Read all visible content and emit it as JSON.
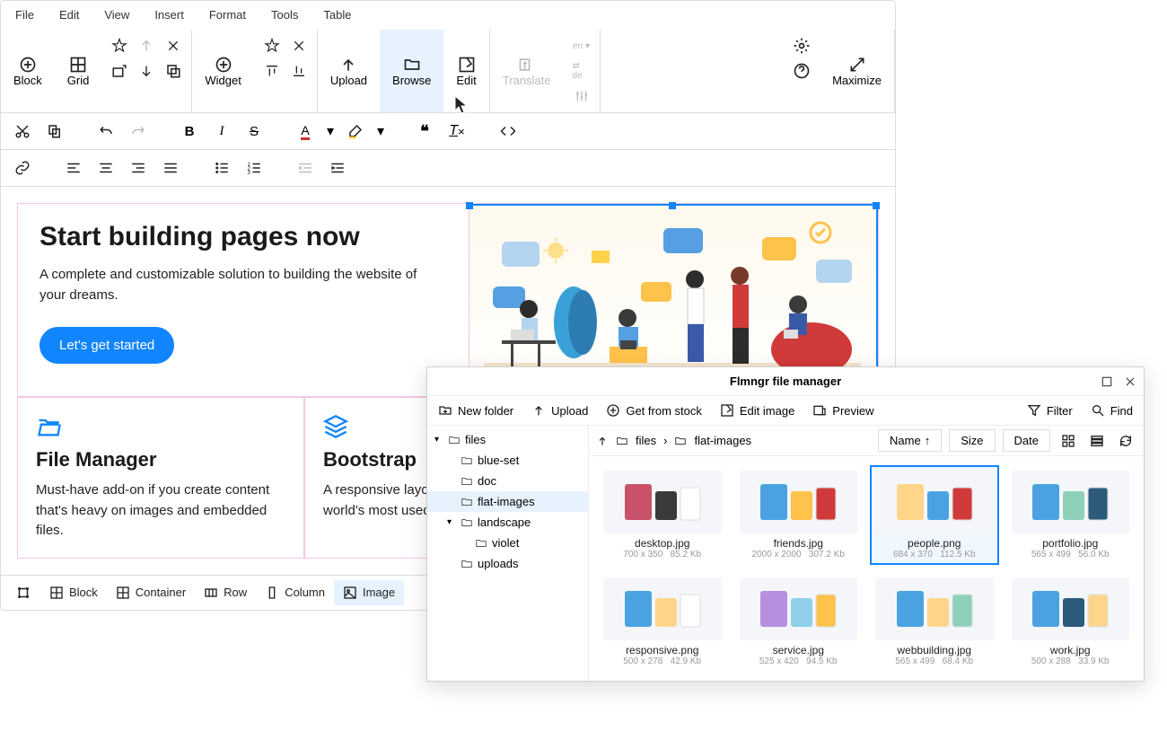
{
  "menu": [
    "File",
    "Edit",
    "View",
    "Insert",
    "Format",
    "Tools",
    "Table"
  ],
  "tools": {
    "block": "Block",
    "grid": "Grid",
    "widget": "Widget",
    "upload": "Upload",
    "browse": "Browse",
    "edit": "Edit",
    "translate": "Translate",
    "maximize": "Maximize"
  },
  "hero": {
    "title": "Start building pages now",
    "desc": "A complete and customizable solution to building the website of your dreams.",
    "cta": "Let's get started"
  },
  "features": [
    {
      "title": "File Manager",
      "desc": "Must-have add-on if you create content that's heavy on images and embedded files."
    },
    {
      "title": "Bootstrap",
      "desc": "A responsive layout built on top of the world's most used framework library."
    }
  ],
  "breadcrumbs": [
    "Block",
    "Container",
    "Row",
    "Column",
    "Image"
  ],
  "dialog": {
    "title": "Flmngr file manager",
    "actions": {
      "newFolder": "New folder",
      "upload": "Upload",
      "stock": "Get from stock",
      "editImage": "Edit image",
      "preview": "Preview",
      "filter": "Filter",
      "find": "Find"
    },
    "tree": [
      {
        "label": "files",
        "indent": 0,
        "expanded": true
      },
      {
        "label": "blue-set",
        "indent": 1
      },
      {
        "label": "doc",
        "indent": 1
      },
      {
        "label": "flat-images",
        "indent": 1,
        "selected": true
      },
      {
        "label": "landscape",
        "indent": 1,
        "expanded": true
      },
      {
        "label": "violet",
        "indent": 2
      },
      {
        "label": "uploads",
        "indent": 1
      }
    ],
    "path": [
      "files",
      "flat-images"
    ],
    "columns": {
      "name": "Name",
      "size": "Size",
      "date": "Date"
    },
    "files": [
      {
        "name": "desktop.jpg",
        "dims": "700 x 350",
        "size": "85.2 Kb"
      },
      {
        "name": "friends.jpg",
        "dims": "2000 x 2000",
        "size": "307.2 Kb"
      },
      {
        "name": "people.png",
        "dims": "684 x 370",
        "size": "112.5 Kb",
        "selected": true
      },
      {
        "name": "portfolio.jpg",
        "dims": "565 x 499",
        "size": "56.0 Kb"
      },
      {
        "name": "responsive.png",
        "dims": "500 x 278",
        "size": "42.9 Kb"
      },
      {
        "name": "service.jpg",
        "dims": "525 x 420",
        "size": "94.5 Kb"
      },
      {
        "name": "webbuilding.jpg",
        "dims": "565 x 499",
        "size": "68.4 Kb"
      },
      {
        "name": "work.jpg",
        "dims": "500 x 288",
        "size": "33.9 Kb"
      }
    ]
  }
}
